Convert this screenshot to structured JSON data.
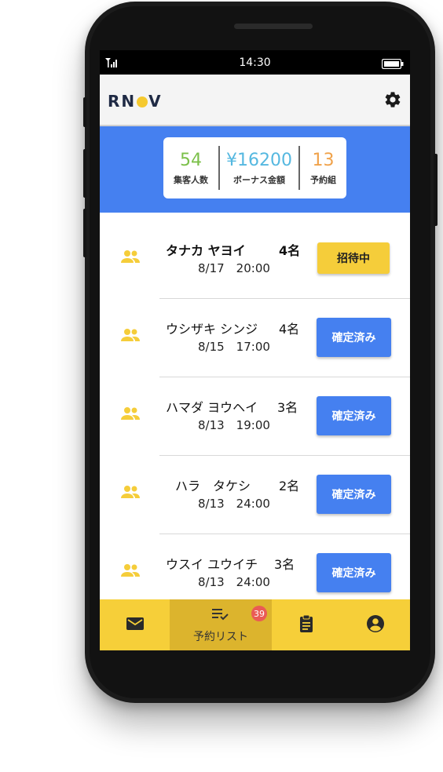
{
  "status": {
    "time": "14:30"
  },
  "app": {
    "logo": [
      "RN",
      "V"
    ]
  },
  "stats": [
    {
      "value": "54",
      "label": "集客人数",
      "color": "#7cc04a"
    },
    {
      "value": "¥16200",
      "label": "ボーナス金額",
      "color": "#55b8e0"
    },
    {
      "value": "13",
      "label": "予約組",
      "color": "#f0a24a"
    }
  ],
  "reservations": [
    {
      "name": "タナカ ヤヨイ",
      "party": "4名",
      "datetime": "8/17　20:00",
      "status": "招待中"
    },
    {
      "name": "ウシザキ シンジ",
      "party": "4名",
      "datetime": "8/15　17:00",
      "status": "確定済み"
    },
    {
      "name": "ハマダ ヨウヘイ",
      "party": "3名",
      "datetime": "8/13　19:00",
      "status": "確定済み"
    },
    {
      "name": "ハラ　タケシ",
      "party": "2名",
      "datetime": "8/13　24:00",
      "status": "確定済み"
    },
    {
      "name": "ウスイ ユウイチ",
      "party": "3名",
      "datetime": "8/13　24:00",
      "status": "確定済み"
    }
  ],
  "nav": {
    "mail_icon": "mail-icon",
    "list_label": "予約リスト",
    "list_badge": "39",
    "clipboard_icon": "clipboard-icon",
    "account_icon": "account-icon"
  },
  "colors": {
    "accent_blue": "#4580f0",
    "accent_yellow": "#f5cd3a"
  }
}
